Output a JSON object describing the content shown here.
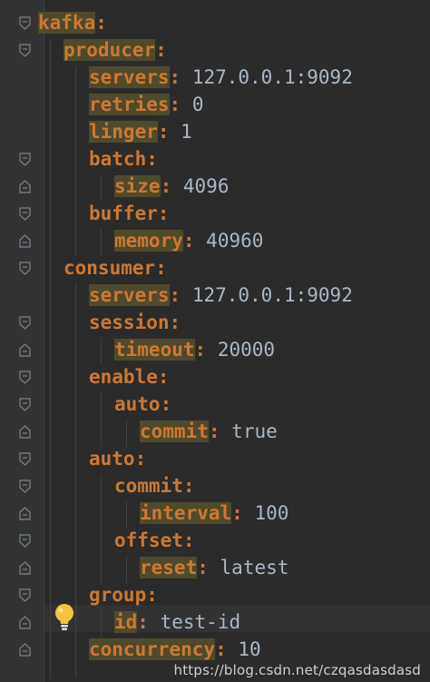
{
  "lines": [
    {
      "key": "kafka",
      "value": ""
    },
    {
      "key": "producer",
      "value": ""
    },
    {
      "key": "servers",
      "value": "127.0.0.1:9092"
    },
    {
      "key": "retries",
      "value": "0"
    },
    {
      "key": "linger",
      "value": "1"
    },
    {
      "key": "batch",
      "value": ""
    },
    {
      "key": "size",
      "value": "4096"
    },
    {
      "key": "buffer",
      "value": ""
    },
    {
      "key": "memory",
      "value": "40960"
    },
    {
      "key": "consumer",
      "value": ""
    },
    {
      "key": "servers",
      "value": "127.0.0.1:9092"
    },
    {
      "key": "session",
      "value": ""
    },
    {
      "key": "timeout",
      "value": "20000"
    },
    {
      "key": "enable",
      "value": ""
    },
    {
      "key": "auto",
      "value": ""
    },
    {
      "key": "commit",
      "value": "true"
    },
    {
      "key": "auto",
      "value": ""
    },
    {
      "key": "commit",
      "value": ""
    },
    {
      "key": "interval",
      "value": "100"
    },
    {
      "key": "offset",
      "value": ""
    },
    {
      "key": "reset",
      "value": "latest"
    },
    {
      "key": "group",
      "value": ""
    },
    {
      "key": "id",
      "value": "test-id"
    },
    {
      "key": "concurrency",
      "value": "10"
    }
  ],
  "separator": ":",
  "gutter_icon": "lightbulb-icon",
  "watermark": "https://blog.csdn.net/czqasdasdasd",
  "colors": {
    "background": "#2b2b2b",
    "gutter": "#313335",
    "key": "#cc7832",
    "key_highlight": "#56502c",
    "value": "#a9b7c6"
  }
}
